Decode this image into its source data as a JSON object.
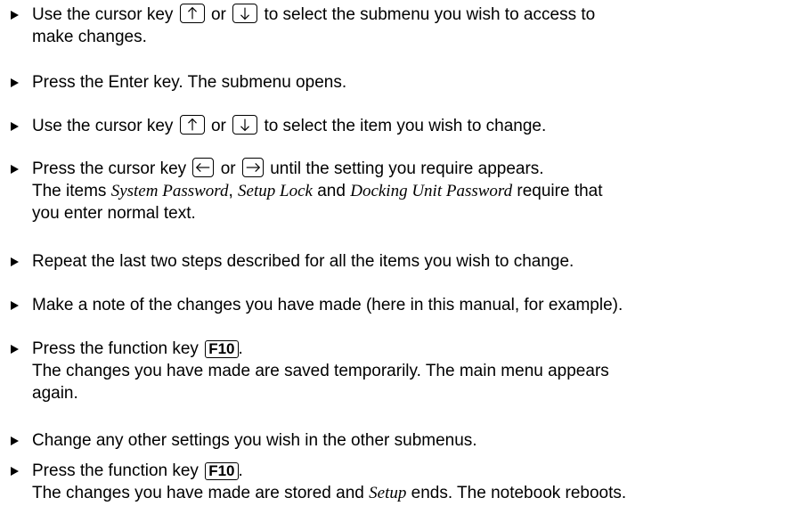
{
  "steps": [
    {
      "pre": "Use the cursor key",
      "or": "or",
      "post": "to select the submenu you wish to access to",
      "line2": "make changes."
    },
    {
      "text": "Press the Enter key. The submenu opens."
    },
    {
      "pre": "Use the cursor key",
      "or": "or",
      "post": "to select the item you wish to change."
    },
    {
      "pre": "Press the cursor key",
      "or": "or",
      "post": "until the setting you require appears.",
      "line2_pre": "The items",
      "item1": "System Password",
      "sep": ",",
      "item2": "Setup Lock",
      "and": "and",
      "item3": "Docking Unit Password",
      "line2_post": "require that",
      "line3": "you enter normal text."
    },
    {
      "text": "Repeat the last two steps described for all the items you wish to change."
    },
    {
      "text": "Make a note of the changes you have made (here in this manual, for example)."
    },
    {
      "pre": "Press the function key",
      "key": "F10",
      "post": ".",
      "line2": "The changes you have made are saved temporarily. The main menu appears",
      "line3": "again."
    },
    {
      "text": "Change any other settings you wish in the other submenus."
    },
    {
      "pre": "Press the function key",
      "key": "F10",
      "post": ".",
      "line2_pre": "The changes you have made are stored and",
      "item": "Setup",
      "line2_post": "ends. The notebook reboots."
    }
  ],
  "icons": {
    "up": "arrow-up-key-icon",
    "down": "arrow-down-key-icon",
    "left": "arrow-left-key-icon",
    "right": "arrow-right-key-icon"
  }
}
